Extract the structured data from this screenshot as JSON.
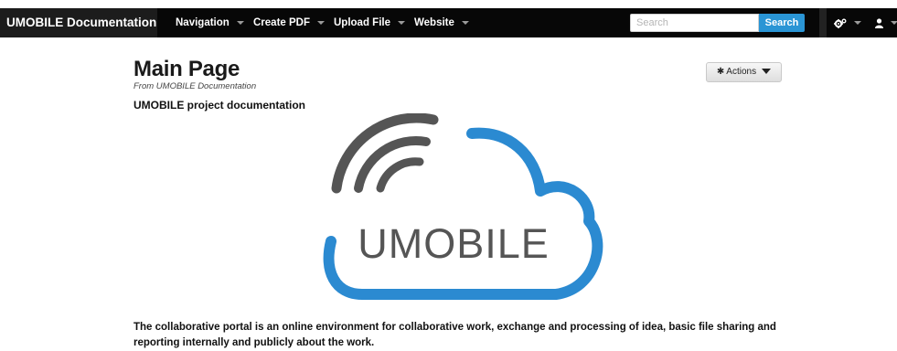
{
  "navbar": {
    "brand": "UMOBILE Documentation",
    "menus": [
      {
        "label": "Navigation"
      },
      {
        "label": "Create PDF"
      },
      {
        "label": "Upload File"
      },
      {
        "label": "Website"
      }
    ],
    "search": {
      "placeholder": "Search",
      "value": "",
      "button_label": "Search"
    },
    "tools": [
      {
        "icon": "cogs-icon"
      },
      {
        "icon": "user-icon"
      }
    ]
  },
  "page": {
    "title": "Main Page",
    "from": "From UMOBILE Documentation",
    "subtitle": "UMOBILE project documentation",
    "actions_label": "Actions",
    "logo_text": "UMOBILE",
    "description": "The collaborative portal is an online environment for collaborative work, exchange and processing of idea, basic file sharing and reporting internally and publicly about the work."
  },
  "colors": {
    "navbar_bg": "#070707",
    "brand_bg": "#1c1c1c",
    "search_button": "#2a95d5",
    "logo_cloud": "#2b8ad1",
    "logo_waves": "#555555",
    "logo_text": "#555555"
  }
}
